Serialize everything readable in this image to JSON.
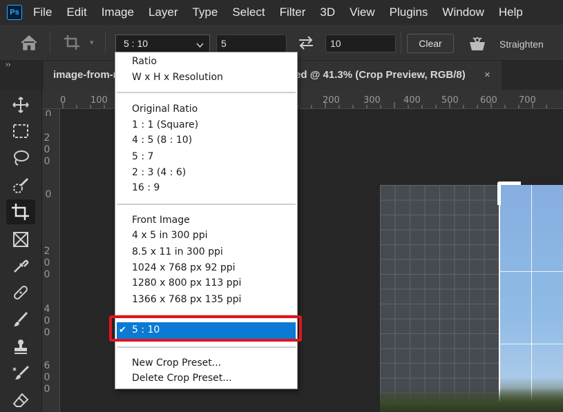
{
  "app": {
    "logo_text": "Ps"
  },
  "menu": [
    "File",
    "Edit",
    "Image",
    "Layer",
    "Type",
    "Select",
    "Filter",
    "3D",
    "View",
    "Plugins",
    "Window",
    "Help"
  ],
  "options": {
    "ratio_value": "5 : 10",
    "width_value": "5",
    "height_value": "10",
    "clear_label": "Clear",
    "straighten_label": "Straighten"
  },
  "tabs": {
    "collapse_glyph": "››",
    "doc_title": "image-from-rawpixel-id-2265773-jpeg.jpg-Enhanced @ 41.3% (Crop Preview, RGB/8)",
    "close_glyph": "×"
  },
  "ruler": {
    "top_labels": [
      "0",
      "100",
      "200",
      "300",
      "400",
      "500",
      "600",
      "700"
    ],
    "left_labels": [
      "0",
      "200",
      "0",
      "200",
      "400",
      "600"
    ]
  },
  "dropdown": {
    "items_group1": [
      "Ratio",
      "W x H x Resolution"
    ],
    "items_group2": [
      "Original Ratio",
      "1 : 1 (Square)",
      "4 : 5 (8 : 10)",
      "5 : 7",
      "2 : 3 (4 : 6)",
      "16 : 9"
    ],
    "items_group3": [
      "Front Image",
      "4 x 5 in 300 ppi",
      "8.5 x 11 in 300 ppi",
      "1024 x 768 px 92 ppi",
      "1280 x 800 px 113 ppi",
      "1366 x 768 px 135 ppi"
    ],
    "selected_label": "5 : 10",
    "check_glyph": "✔",
    "items_group5": [
      "New Crop Preset...",
      "Delete Crop Preset..."
    ]
  },
  "colors": {
    "accent_selected": "#0a7ad4",
    "highlight_box": "#e0141e",
    "ps_blue": "#31a8ff"
  },
  "toolbar_icons": [
    "move-icon",
    "marquee-icon",
    "lasso-icon",
    "quick-select-icon",
    "crop-icon",
    "frame-icon",
    "eyedropper-icon",
    "healing-icon",
    "brush-icon",
    "stamp-icon",
    "history-brush-icon",
    "eraser-icon"
  ]
}
